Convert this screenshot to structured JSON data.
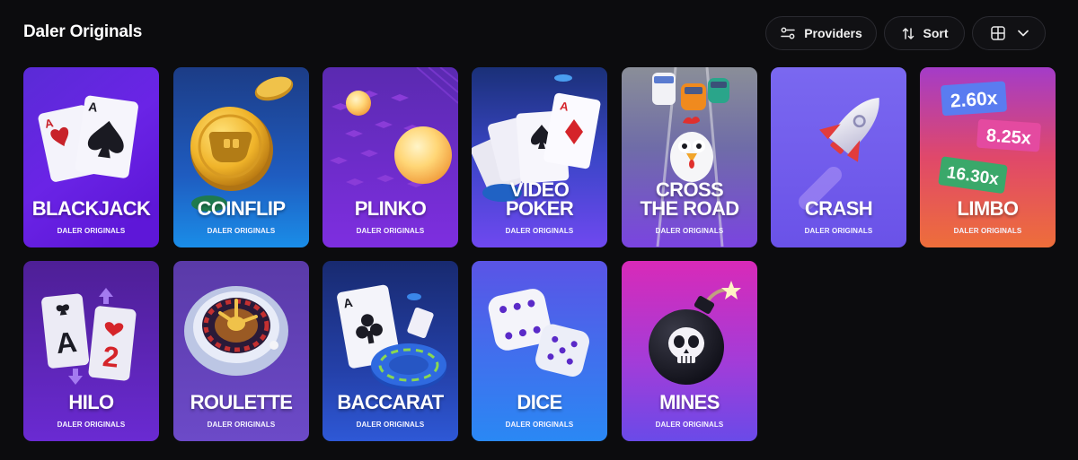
{
  "header": {
    "title": "Daler Originals",
    "providers_label": "Providers",
    "sort_label": "Sort",
    "view_icon": "grid-view-icon",
    "dropdown_icon": "chevron-down-icon"
  },
  "games": [
    {
      "id": "blackjack",
      "line1": "BLACKJACK",
      "line2": "",
      "subtitle": "DALER ORIGINALS"
    },
    {
      "id": "coinflip",
      "line1": "COINFLIP",
      "line2": "",
      "subtitle": "DALER ORIGINALS"
    },
    {
      "id": "plinko",
      "line1": "PLINKO",
      "line2": "",
      "subtitle": "DALER ORIGINALS"
    },
    {
      "id": "video-poker",
      "line1": "VIDEO",
      "line2": "POKER",
      "subtitle": "DALER ORIGINALS"
    },
    {
      "id": "cross-the-road",
      "line1": "CROSS",
      "line2": "THE ROAD",
      "subtitle": "DALER ORIGINALS"
    },
    {
      "id": "crash",
      "line1": "CRASH",
      "line2": "",
      "subtitle": "DALER ORIGINALS"
    },
    {
      "id": "limbo",
      "line1": "LIMBO",
      "line2": "",
      "subtitle": "DALER ORIGINALS",
      "multipliers": [
        "2.60x",
        "8.25x",
        "16.30x"
      ]
    },
    {
      "id": "hilo",
      "line1": "HILO",
      "line2": "",
      "subtitle": "DALER ORIGINALS",
      "cards": [
        "A",
        "2"
      ]
    },
    {
      "id": "roulette",
      "line1": "ROULETTE",
      "line2": "",
      "subtitle": "DALER ORIGINALS"
    },
    {
      "id": "baccarat",
      "line1": "BACCARAT",
      "line2": "",
      "subtitle": "DALER ORIGINALS",
      "card_rank": "A"
    },
    {
      "id": "dice",
      "line1": "DICE",
      "line2": "",
      "subtitle": "DALER ORIGINALS"
    },
    {
      "id": "mines",
      "line1": "MINES",
      "line2": "",
      "subtitle": "DALER ORIGINALS"
    }
  ]
}
